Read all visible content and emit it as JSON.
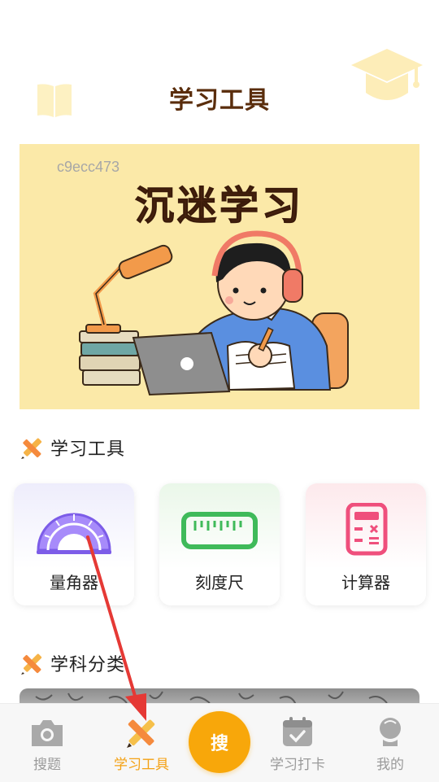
{
  "header": {
    "title": "学习工具",
    "left_icon": "book-icon",
    "right_icon": "graduation-cap-icon"
  },
  "banner": {
    "id_text": "c9ecc473",
    "title": "沉迷学习"
  },
  "sections": {
    "tools": {
      "label": "学习工具",
      "icon": "pencil-ruler-icon"
    },
    "subjects": {
      "label": "学科分类",
      "icon": "pencil-ruler-icon"
    }
  },
  "tools": [
    {
      "label": "量角器",
      "icon": "protractor-icon"
    },
    {
      "label": "刻度尺",
      "icon": "ruler-icon"
    },
    {
      "label": "计算器",
      "icon": "calculator-icon"
    }
  ],
  "nav": {
    "items": [
      {
        "label": "搜题",
        "icon": "camera-icon"
      },
      {
        "label": "学习工具",
        "icon": "pencil-ruler-icon",
        "active": true
      },
      {
        "label": "学习打卡",
        "icon": "calendar-check-icon"
      },
      {
        "label": "我的",
        "icon": "profile-icon"
      }
    ],
    "search_label": "搜"
  },
  "colors": {
    "accent": "#f8a70a",
    "title_brown": "#5a2d0c",
    "banner_bg": "#fbe9a8",
    "nav_inactive": "#9a9a9a",
    "annotation_arrow": "#e53935"
  }
}
